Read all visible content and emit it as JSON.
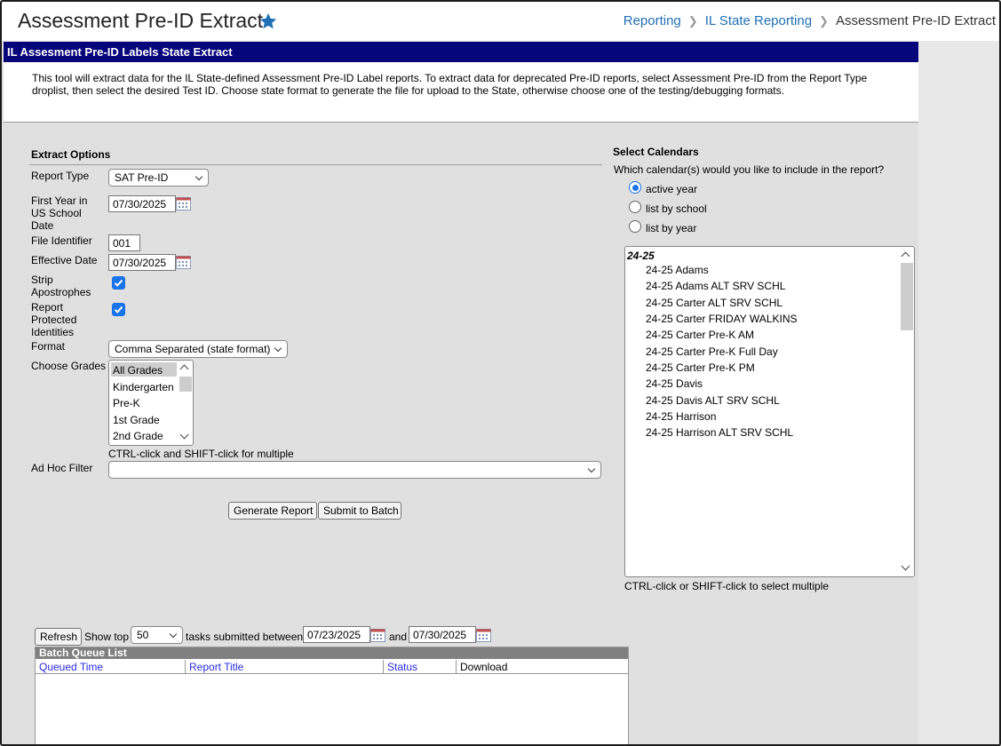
{
  "header": {
    "title": "Assessment Pre-ID Extract",
    "breadcrumb": [
      "Reporting",
      "IL State Reporting",
      "Assessment Pre-ID Extract"
    ]
  },
  "panel": {
    "heading": "IL Assesment Pre-ID Labels State Extract",
    "description": "This tool will extract data for the IL State-defined Assessment Pre-ID Label reports. To extract data for deprecated Pre-ID reports, select Assessment Pre-ID from the Report Type droplist, then select the desired Test ID. Choose state format to generate the file for upload to the State, otherwise choose one of the testing/debugging formats."
  },
  "extract_options": {
    "title": "Extract Options",
    "report_type_label": "Report Type",
    "report_type_value": "SAT Pre-ID",
    "first_year_label": "First Year in US School Date",
    "first_year_value": "07/30/2025",
    "file_identifier_label": "File Identifier",
    "file_identifier_value": "001",
    "effective_date_label": "Effective Date",
    "effective_date_value": "07/30/2025",
    "strip_apostrophes_label": "Strip Apostrophes",
    "strip_apostrophes_checked": true,
    "report_protected_label": "Report Protected Identities",
    "report_protected_checked": true,
    "format_label": "Format",
    "format_value": "Comma Separated (state format)",
    "grades_label": "Choose Grades",
    "grades": [
      "All Grades",
      "Kindergarten",
      "Pre-K",
      "1st Grade",
      "2nd Grade"
    ],
    "grades_selected": "All Grades",
    "grades_hint": "CTRL-click and SHIFT-click for multiple",
    "adhoc_label": "Ad Hoc Filter",
    "adhoc_value": "",
    "generate_button": "Generate Report",
    "batch_button": "Submit to Batch"
  },
  "calendars": {
    "title": "Select Calendars",
    "question": "Which calendar(s) would you like to include in the report?",
    "options": [
      "active year",
      "list by school",
      "list by year"
    ],
    "selected_option": "active year",
    "group": "24-25",
    "items": [
      "24-25 Adams",
      "24-25 Adams ALT SRV SCHL",
      "24-25 Carter ALT SRV SCHL",
      "24-25 Carter FRIDAY WALKINS",
      "24-25 Carter Pre-K AM",
      "24-25 Carter Pre-K Full Day",
      "24-25 Carter Pre-K PM",
      "24-25 Davis",
      "24-25 Davis ALT SRV SCHL",
      "24-25 Harrison",
      "24-25 Harrison ALT SRV SCHL"
    ],
    "hint": "CTRL-click or SHIFT-click to select multiple"
  },
  "batch": {
    "refresh_button": "Refresh",
    "show_top_label": "Show top",
    "show_top_value": "50",
    "between_label": "tasks submitted between",
    "start_date": "07/23/2025",
    "and_label": "and",
    "end_date": "07/30/2025",
    "list_title": "Batch Queue List",
    "columns": [
      "Queued Time",
      "Report Title",
      "Status",
      "Download"
    ]
  },
  "colors": {
    "panel_header_bg": "#06057a",
    "link": "#1f6fb5",
    "accent": "#1a73e8",
    "background": "#e0e0e0"
  }
}
